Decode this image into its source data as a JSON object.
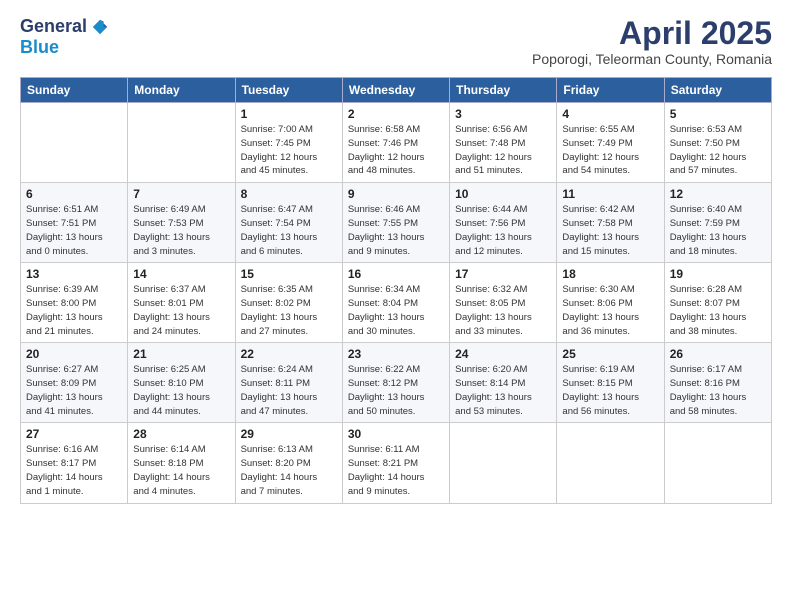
{
  "header": {
    "logo_general": "General",
    "logo_blue": "Blue",
    "month_title": "April 2025",
    "location": "Poporogi, Teleorman County, Romania"
  },
  "days_of_week": [
    "Sunday",
    "Monday",
    "Tuesday",
    "Wednesday",
    "Thursday",
    "Friday",
    "Saturday"
  ],
  "weeks": [
    [
      {
        "day": "",
        "info": ""
      },
      {
        "day": "",
        "info": ""
      },
      {
        "day": "1",
        "info": "Sunrise: 7:00 AM\nSunset: 7:45 PM\nDaylight: 12 hours\nand 45 minutes."
      },
      {
        "day": "2",
        "info": "Sunrise: 6:58 AM\nSunset: 7:46 PM\nDaylight: 12 hours\nand 48 minutes."
      },
      {
        "day": "3",
        "info": "Sunrise: 6:56 AM\nSunset: 7:48 PM\nDaylight: 12 hours\nand 51 minutes."
      },
      {
        "day": "4",
        "info": "Sunrise: 6:55 AM\nSunset: 7:49 PM\nDaylight: 12 hours\nand 54 minutes."
      },
      {
        "day": "5",
        "info": "Sunrise: 6:53 AM\nSunset: 7:50 PM\nDaylight: 12 hours\nand 57 minutes."
      }
    ],
    [
      {
        "day": "6",
        "info": "Sunrise: 6:51 AM\nSunset: 7:51 PM\nDaylight: 13 hours\nand 0 minutes."
      },
      {
        "day": "7",
        "info": "Sunrise: 6:49 AM\nSunset: 7:53 PM\nDaylight: 13 hours\nand 3 minutes."
      },
      {
        "day": "8",
        "info": "Sunrise: 6:47 AM\nSunset: 7:54 PM\nDaylight: 13 hours\nand 6 minutes."
      },
      {
        "day": "9",
        "info": "Sunrise: 6:46 AM\nSunset: 7:55 PM\nDaylight: 13 hours\nand 9 minutes."
      },
      {
        "day": "10",
        "info": "Sunrise: 6:44 AM\nSunset: 7:56 PM\nDaylight: 13 hours\nand 12 minutes."
      },
      {
        "day": "11",
        "info": "Sunrise: 6:42 AM\nSunset: 7:58 PM\nDaylight: 13 hours\nand 15 minutes."
      },
      {
        "day": "12",
        "info": "Sunrise: 6:40 AM\nSunset: 7:59 PM\nDaylight: 13 hours\nand 18 minutes."
      }
    ],
    [
      {
        "day": "13",
        "info": "Sunrise: 6:39 AM\nSunset: 8:00 PM\nDaylight: 13 hours\nand 21 minutes."
      },
      {
        "day": "14",
        "info": "Sunrise: 6:37 AM\nSunset: 8:01 PM\nDaylight: 13 hours\nand 24 minutes."
      },
      {
        "day": "15",
        "info": "Sunrise: 6:35 AM\nSunset: 8:02 PM\nDaylight: 13 hours\nand 27 minutes."
      },
      {
        "day": "16",
        "info": "Sunrise: 6:34 AM\nSunset: 8:04 PM\nDaylight: 13 hours\nand 30 minutes."
      },
      {
        "day": "17",
        "info": "Sunrise: 6:32 AM\nSunset: 8:05 PM\nDaylight: 13 hours\nand 33 minutes."
      },
      {
        "day": "18",
        "info": "Sunrise: 6:30 AM\nSunset: 8:06 PM\nDaylight: 13 hours\nand 36 minutes."
      },
      {
        "day": "19",
        "info": "Sunrise: 6:28 AM\nSunset: 8:07 PM\nDaylight: 13 hours\nand 38 minutes."
      }
    ],
    [
      {
        "day": "20",
        "info": "Sunrise: 6:27 AM\nSunset: 8:09 PM\nDaylight: 13 hours\nand 41 minutes."
      },
      {
        "day": "21",
        "info": "Sunrise: 6:25 AM\nSunset: 8:10 PM\nDaylight: 13 hours\nand 44 minutes."
      },
      {
        "day": "22",
        "info": "Sunrise: 6:24 AM\nSunset: 8:11 PM\nDaylight: 13 hours\nand 47 minutes."
      },
      {
        "day": "23",
        "info": "Sunrise: 6:22 AM\nSunset: 8:12 PM\nDaylight: 13 hours\nand 50 minutes."
      },
      {
        "day": "24",
        "info": "Sunrise: 6:20 AM\nSunset: 8:14 PM\nDaylight: 13 hours\nand 53 minutes."
      },
      {
        "day": "25",
        "info": "Sunrise: 6:19 AM\nSunset: 8:15 PM\nDaylight: 13 hours\nand 56 minutes."
      },
      {
        "day": "26",
        "info": "Sunrise: 6:17 AM\nSunset: 8:16 PM\nDaylight: 13 hours\nand 58 minutes."
      }
    ],
    [
      {
        "day": "27",
        "info": "Sunrise: 6:16 AM\nSunset: 8:17 PM\nDaylight: 14 hours\nand 1 minute."
      },
      {
        "day": "28",
        "info": "Sunrise: 6:14 AM\nSunset: 8:18 PM\nDaylight: 14 hours\nand 4 minutes."
      },
      {
        "day": "29",
        "info": "Sunrise: 6:13 AM\nSunset: 8:20 PM\nDaylight: 14 hours\nand 7 minutes."
      },
      {
        "day": "30",
        "info": "Sunrise: 6:11 AM\nSunset: 8:21 PM\nDaylight: 14 hours\nand 9 minutes."
      },
      {
        "day": "",
        "info": ""
      },
      {
        "day": "",
        "info": ""
      },
      {
        "day": "",
        "info": ""
      }
    ]
  ]
}
